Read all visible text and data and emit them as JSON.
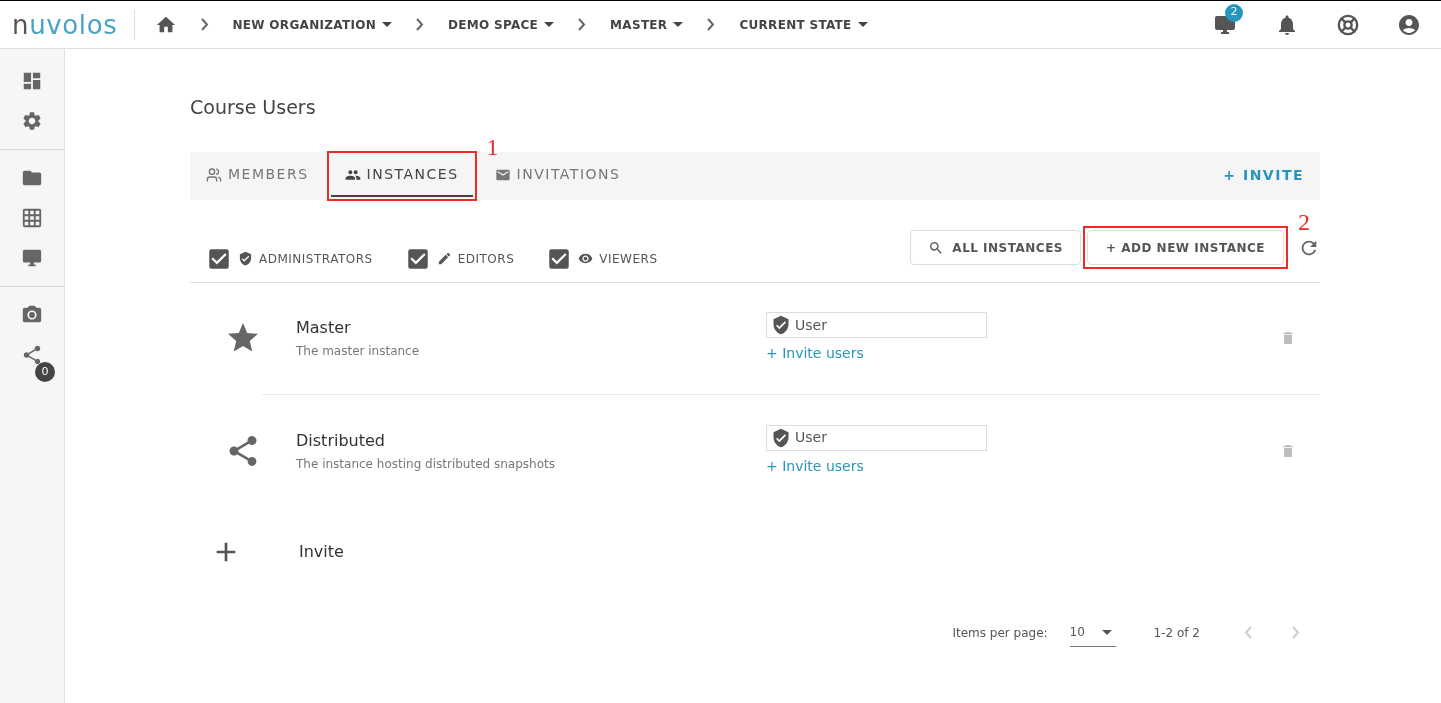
{
  "logo": "nuvolos",
  "breadcrumbs": [
    {
      "label": "NEW ORGANIZATION"
    },
    {
      "label": "DEMO SPACE"
    },
    {
      "label": "MASTER"
    },
    {
      "label": "CURRENT STATE"
    }
  ],
  "top_actions": {
    "monitor_badge": "2"
  },
  "sidebar": {
    "items": [
      {
        "kind": "dashboard"
      },
      {
        "kind": "settings"
      },
      {
        "kind": "divider"
      },
      {
        "kind": "folder"
      },
      {
        "kind": "table"
      },
      {
        "kind": "monitor"
      },
      {
        "kind": "divider"
      },
      {
        "kind": "camera"
      },
      {
        "kind": "share",
        "badge": "0"
      }
    ]
  },
  "page_title": "Course Users",
  "tabs": [
    {
      "label": "MEMBERS",
      "kind": "members",
      "selected": false
    },
    {
      "label": "INSTANCES",
      "kind": "instances",
      "selected": true,
      "annotation": "1"
    },
    {
      "label": "INVITATIONS",
      "kind": "invitations",
      "selected": false
    }
  ],
  "invite_button": "+ INVITE",
  "filters": [
    {
      "label": "ADMINISTRATORS",
      "kind": "admin",
      "checked": true
    },
    {
      "label": "EDITORS",
      "kind": "editor",
      "checked": true
    },
    {
      "label": "VIEWERS",
      "kind": "viewer",
      "checked": true
    }
  ],
  "all_instances_button": "ALL INSTANCES",
  "add_instance_button": {
    "label": "+ ADD NEW INSTANCE",
    "annotation": "2"
  },
  "instances": [
    {
      "kind": "star",
      "name": "Master",
      "description": "The master instance",
      "role": "User",
      "invite_link": "+ Invite users"
    },
    {
      "kind": "share",
      "name": "Distributed",
      "description": "The instance hosting distributed snapshots",
      "role": "User",
      "invite_link": "+ Invite users"
    }
  ],
  "invite_row": "Invite",
  "pagination": {
    "items_per_page_label": "Items per page:",
    "items_per_page": "10",
    "range": "1-2 of 2"
  }
}
